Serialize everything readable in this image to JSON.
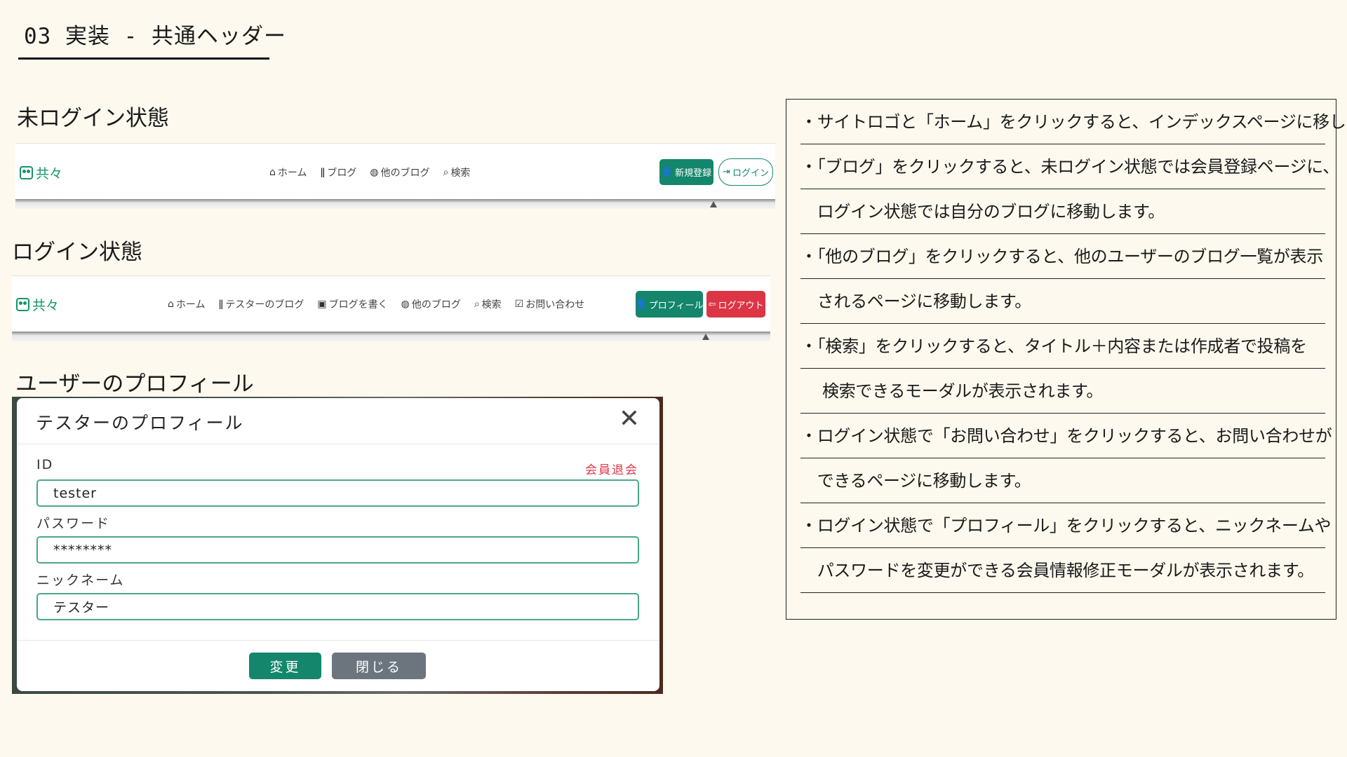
{
  "slide": {
    "title": "03 実装 - 共通ヘッダー"
  },
  "sections": {
    "logged_out": "未ログイン状態",
    "logged_in": "ログイン状態",
    "profile": "ユーザーのプロフィール"
  },
  "header_logged_out": {
    "logo_text": "共々",
    "nav": [
      "ホーム",
      "ブログ",
      "他のブログ",
      "検索"
    ],
    "signup_label": "新規登録",
    "login_label": "ログイン"
  },
  "header_logged_in": {
    "logo_text": "共々",
    "nav": [
      "ホーム",
      "テスターのブログ",
      "ブログを書く",
      "他のブログ",
      "検索",
      "お問い合わせ"
    ],
    "profile_label": "プロフィール",
    "logout_label": "ログアウト"
  },
  "profile_modal": {
    "title": "テスターのプロフィール",
    "close_glyph": "✕",
    "id_label": "ID",
    "withdraw_label": "会員退会",
    "id_value": "tester",
    "password_label": "パスワード",
    "password_value": "********",
    "nickname_label": "ニックネーム",
    "nickname_value": "テスター",
    "change_label": "変更",
    "close_label": "閉じる"
  },
  "notes": [
    "・サイトロゴと「ホーム」をクリックすると、インデックスページに移します。",
    "・「ブログ」をクリックすると、未ログイン状態では会員登録ページに、",
    "　ログイン状態では自分のブログに移動します。",
    "・「他のブログ」をクリックすると、他のユーザーのブログ一覧が表示",
    "　されるページに移動します。",
    "・「検索」をクリックすると、タイトル＋内容または作成者で投稿を",
    "　 検索できるモーダルが表示されます。",
    "・ログイン状態で「お問い合わせ」をクリックすると、お問い合わせが",
    "　できるページに移動します。",
    "・ログイン状態で「プロフィール」をクリックすると、ニックネームや",
    "　パスワードを変更ができる会員情報修正モーダルが表示されます。"
  ],
  "colors": {
    "background": "#fdf9ee",
    "brand_green": "#14866b",
    "danger_red": "#dc3545",
    "secondary_gray": "#6c757d"
  }
}
